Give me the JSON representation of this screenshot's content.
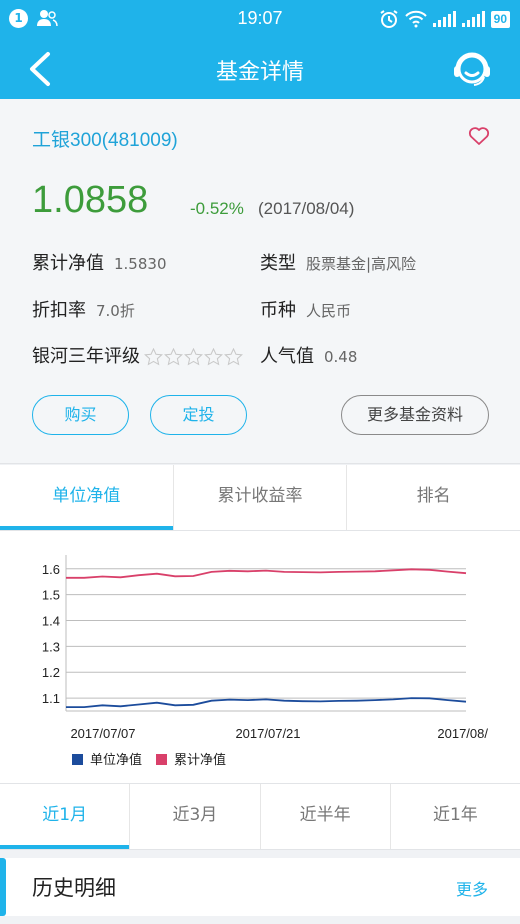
{
  "status_bar": {
    "badge": "1",
    "time": "19:07",
    "battery": "90"
  },
  "header": {
    "title": "基金详情"
  },
  "fund": {
    "name": "工银300(481009)",
    "nav": "1.0858",
    "change": "-0.52%",
    "date": "(2017/08/04)",
    "rows": [
      {
        "label": "累计净值",
        "value": "1.5830"
      },
      {
        "label": "类型",
        "value": "股票基金|高风险"
      },
      {
        "label": "折扣率",
        "value": "7.0折"
      },
      {
        "label": "币种",
        "value": "人民币"
      },
      {
        "label": "银河三年评级",
        "value": ""
      },
      {
        "label": "人气值",
        "value": "0.48"
      }
    ],
    "rating_stars": 0
  },
  "actions": {
    "buy": "购买",
    "fixed": "定投",
    "more_info": "更多基金资料"
  },
  "tabs": [
    {
      "label": "单位净值",
      "active": true
    },
    {
      "label": "累计收益率",
      "active": false
    },
    {
      "label": "排名",
      "active": false
    }
  ],
  "chart_data": {
    "type": "line",
    "x": [
      "2017/07/05",
      "2017/07/06",
      "2017/07/07",
      "2017/07/10",
      "2017/07/11",
      "2017/07/12",
      "2017/07/13",
      "2017/07/14",
      "2017/07/17",
      "2017/07/18",
      "2017/07/19",
      "2017/07/20",
      "2017/07/21",
      "2017/07/24",
      "2017/07/25",
      "2017/07/26",
      "2017/07/27",
      "2017/07/28",
      "2017/07/31",
      "2017/08/01",
      "2017/08/02",
      "2017/08/03",
      "2017/08/04"
    ],
    "x_tick_labels": [
      "2017/07/07",
      "2017/07/21",
      "2017/08/"
    ],
    "y_ticks": [
      "1.6",
      "1.5",
      "1.4",
      "1.3",
      "1.2",
      "1.1"
    ],
    "ylim": [
      1.05,
      1.63
    ],
    "grid": true,
    "legend_position": "bottom-left",
    "series": [
      {
        "name": "单位净值",
        "color": "#1c4c9c",
        "values": [
          1.065,
          1.065,
          1.072,
          1.068,
          1.075,
          1.082,
          1.072,
          1.074,
          1.09,
          1.094,
          1.092,
          1.095,
          1.09,
          1.088,
          1.087,
          1.089,
          1.09,
          1.092,
          1.095,
          1.1,
          1.099,
          1.092,
          1.086
        ]
      },
      {
        "name": "累计净值",
        "color": "#d9406a",
        "values": [
          1.565,
          1.565,
          1.57,
          1.567,
          1.575,
          1.581,
          1.571,
          1.572,
          1.588,
          1.592,
          1.59,
          1.593,
          1.588,
          1.587,
          1.586,
          1.588,
          1.589,
          1.59,
          1.594,
          1.598,
          1.596,
          1.589,
          1.583
        ]
      }
    ]
  },
  "periods": [
    {
      "label": "近1月",
      "active": true
    },
    {
      "label": "近3月",
      "active": false
    },
    {
      "label": "近半年",
      "active": false
    },
    {
      "label": "近1年",
      "active": false
    }
  ],
  "history": {
    "title": "历史明细",
    "more": "更多"
  },
  "colors": {
    "accent": "#1fb3ea",
    "up_green": "#3d9c3b",
    "favorite": "#d9406a"
  }
}
